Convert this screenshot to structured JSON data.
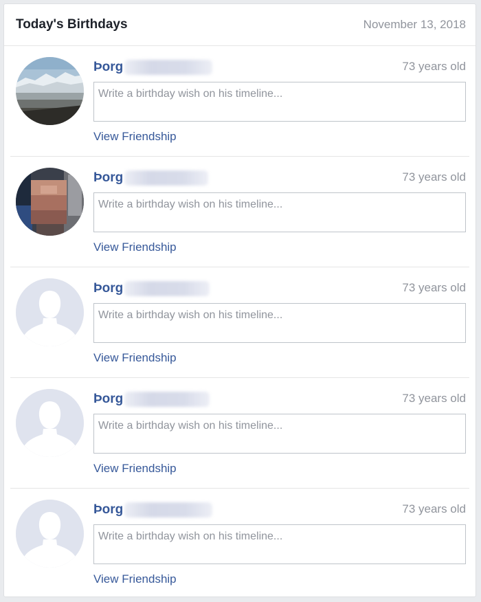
{
  "header": {
    "title": "Today's Birthdays",
    "date": "November 13, 2018"
  },
  "entries": [
    {
      "name": "Þorg",
      "age": "73 years old",
      "placeholder": "Write a birthday wish on his timeline...",
      "link": "View Friendship",
      "avatar": "landscape-photo"
    },
    {
      "name": "Þorg",
      "age": "73 years old",
      "placeholder": "Write a birthday wish on his timeline...",
      "link": "View Friendship",
      "avatar": "blurred-face-photo"
    },
    {
      "name": "Þorg",
      "age": "73 years old",
      "placeholder": "Write a birthday wish on his timeline...",
      "link": "View Friendship",
      "avatar": "default-silhouette"
    },
    {
      "name": "Þorg",
      "age": "73 years old",
      "placeholder": "Write a birthday wish on his timeline...",
      "link": "View Friendship",
      "avatar": "default-silhouette"
    },
    {
      "name": "Þorg",
      "age": "73 years old",
      "placeholder": "Write a birthday wish on his timeline...",
      "link": "View Friendship",
      "avatar": "default-silhouette"
    }
  ],
  "colors": {
    "link": "#365899",
    "muted": "#90949c",
    "border": "#bec3c9"
  }
}
